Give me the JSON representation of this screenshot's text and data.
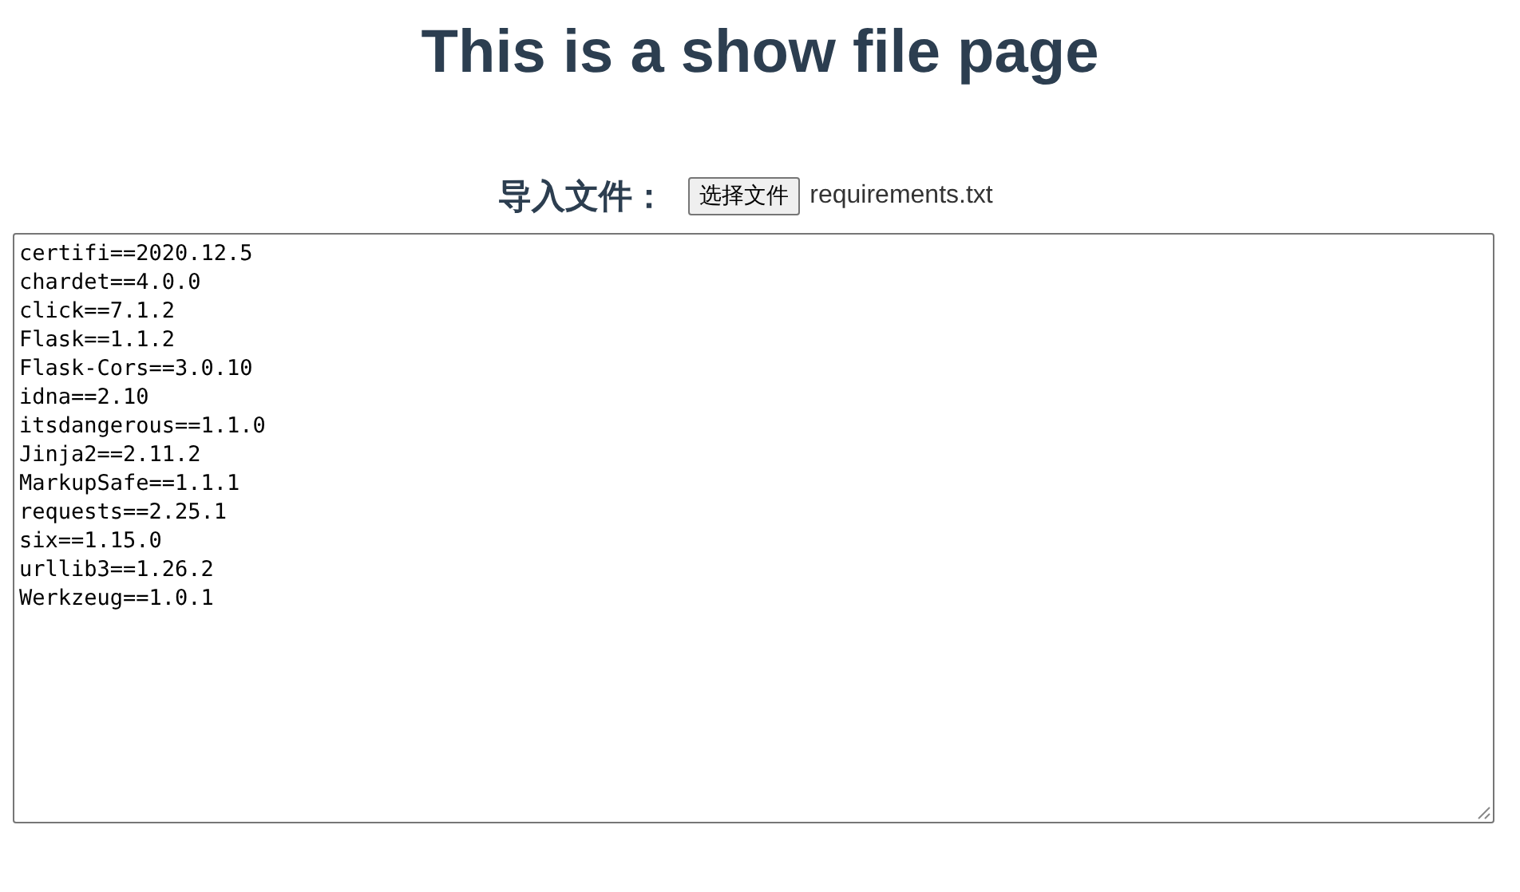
{
  "title": "This is a show file page",
  "import": {
    "label": "导入文件：",
    "button": "选择文件",
    "file_name": "requirements.txt"
  },
  "file_content": {
    "lines": [
      "certifi==2020.12.5",
      "chardet==4.0.0",
      "click==7.1.2",
      "Flask==1.1.2",
      "Flask-Cors==3.0.10",
      "idna==2.10",
      "itsdangerous==1.1.0",
      "Jinja2==2.11.2",
      "MarkupSafe==1.1.1",
      "requests==2.25.1",
      "six==1.15.0",
      "urllib3==1.26.2",
      "Werkzeug==1.0.1"
    ]
  }
}
